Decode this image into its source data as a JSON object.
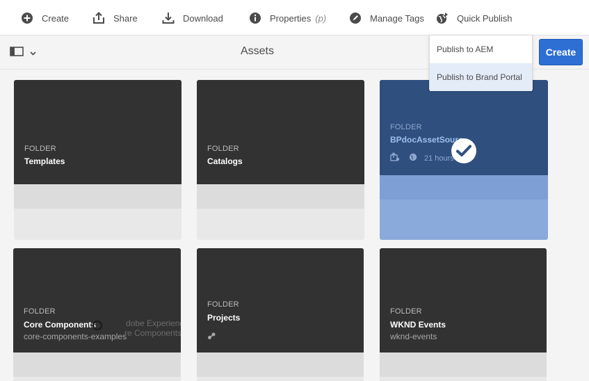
{
  "toolbar": {
    "create": "Create",
    "share": "Share",
    "download": "Download",
    "properties": "Properties",
    "properties_shortcut": "(p)",
    "manage_tags": "Manage Tags",
    "quick_publish": "Quick Publish"
  },
  "titlebar": {
    "title": "Assets",
    "create_button": "Create"
  },
  "quick_publish_menu": [
    {
      "label": "Publish to AEM"
    },
    {
      "label": "Publish to Brand Portal"
    }
  ],
  "cards": [
    {
      "type": "FOLDER",
      "name": "Templates"
    },
    {
      "type": "FOLDER",
      "name": "Catalogs"
    },
    {
      "type": "FOLDER",
      "name": "BPdocAssetSourc",
      "meta": "21 hours a"
    },
    {
      "type": "FOLDER",
      "name": "Core Components",
      "sub": "core-components-examples",
      "ghost1": "dobe Experienc",
      "ghost2": "re Components"
    },
    {
      "type": "FOLDER",
      "name": "Projects"
    },
    {
      "type": "FOLDER",
      "name": "WKND Events",
      "sub": "wknd-events"
    }
  ],
  "colors": {
    "accent": "#2d6fd2",
    "card_dark": "#323232",
    "selected": "#2f4f7e"
  }
}
